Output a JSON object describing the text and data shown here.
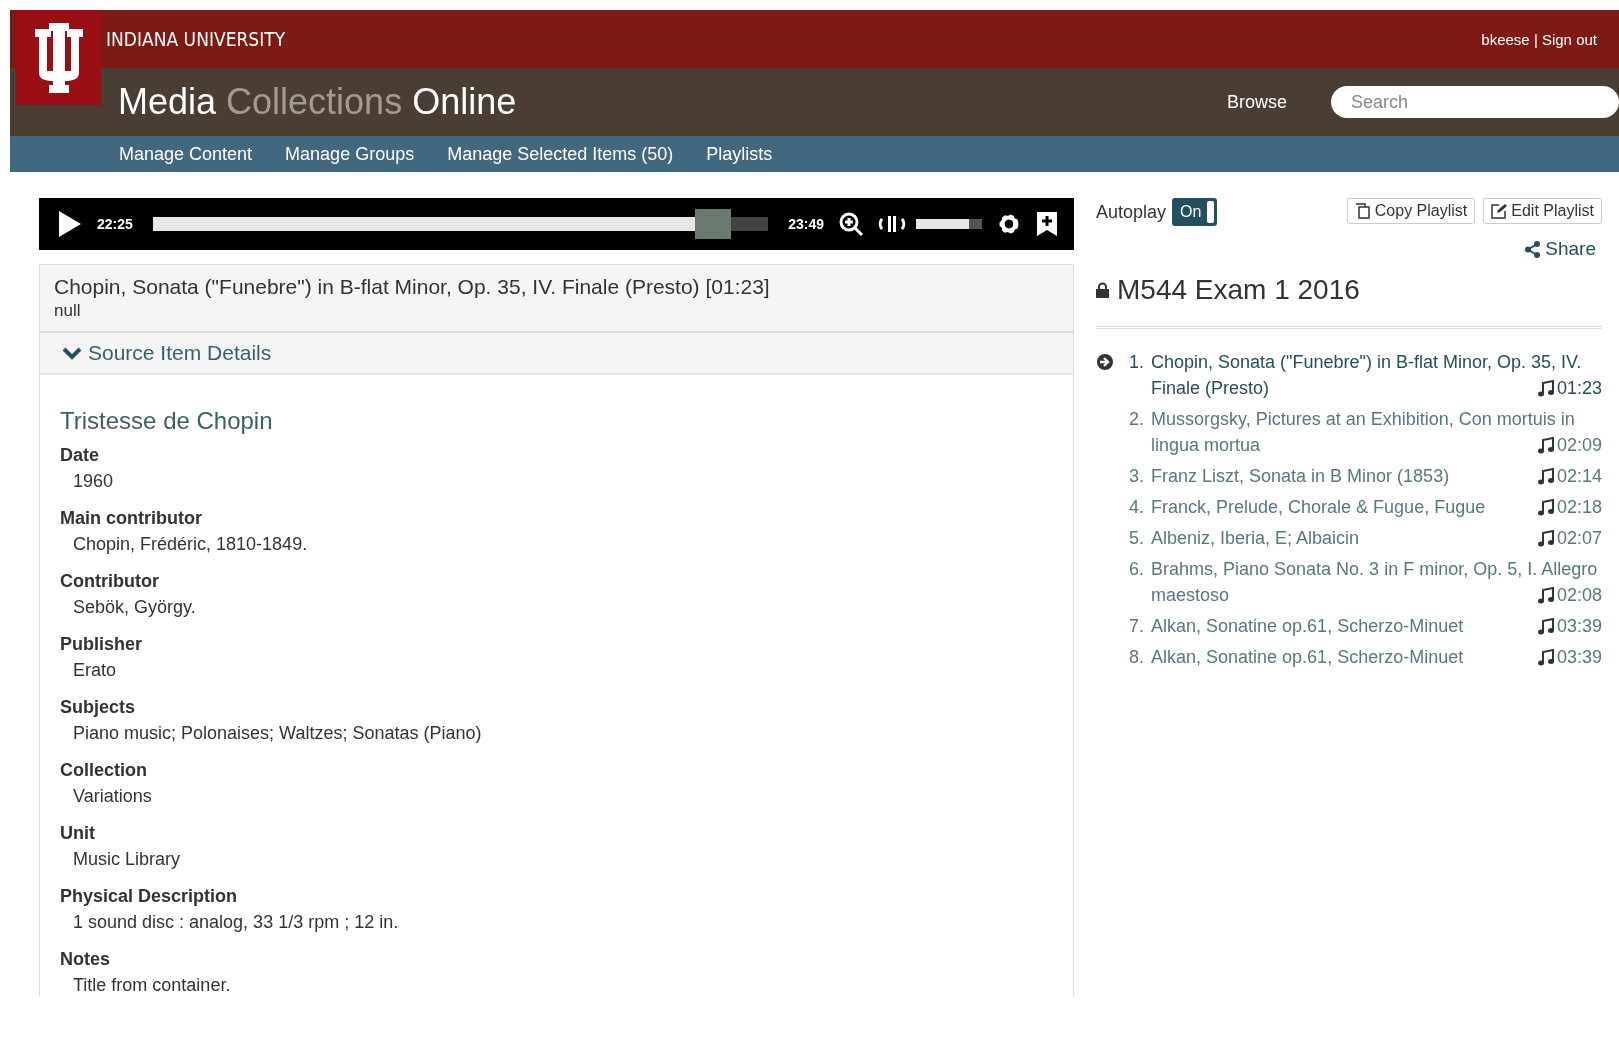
{
  "header": {
    "brand": "INDIANA UNIVERSITY",
    "user": "bkeese | Sign out",
    "title_parts": [
      {
        "text": "Media ",
        "muted": false
      },
      {
        "text": "Collections ",
        "muted": true
      },
      {
        "text": "Online",
        "muted": false
      }
    ],
    "browse": "Browse",
    "search": {
      "placeholder": "Search"
    }
  },
  "nav": [
    "Manage Content",
    "Manage Groups",
    "Manage Selected Items (50)",
    "Playlists"
  ],
  "player": {
    "current_time": "22:25",
    "duration": "23:49",
    "progress": {
      "level": 0.94
    },
    "volume": {
      "level": 0.8
    }
  },
  "item": {
    "title": "Chopin, Sonata (\"Funebre\") in B-flat Minor, Op. 35, IV. Finale (Presto) [01:23]",
    "subtitle": "null",
    "section": {
      "label": "Source Item Details",
      "expanded": true
    },
    "source_title": "Tristesse de Chopin",
    "fields": [
      {
        "label": "Date",
        "value": "1960"
      },
      {
        "label": "Main contributor",
        "value": "Chopin, Frédéric, 1810-1849."
      },
      {
        "label": "Contributor",
        "value": "Sebök, György."
      },
      {
        "label": "Publisher",
        "value": "Erato"
      },
      {
        "label": "Subjects",
        "value": "Piano music; Polonaises; Waltzes; Sonatas (Piano)"
      },
      {
        "label": "Collection",
        "value": "Variations"
      },
      {
        "label": "Unit",
        "value": "Music Library"
      },
      {
        "label": "Physical Description",
        "value": "1 sound disc : analog, 33 1/3 rpm ; 12 in."
      },
      {
        "label": "Notes",
        "value": "Title from container."
      }
    ]
  },
  "playlist": {
    "autoplay": {
      "label": "Autoplay",
      "state": "On",
      "on": true
    },
    "buttons": [
      "Copy Playlist",
      "Edit Playlist"
    ],
    "share": "Share",
    "title": "M544 Exam 1 2016",
    "items": [
      {
        "number": "1.",
        "title": "Chopin, Sonata (\"Funebre\") in B-flat Minor, Op. 35, IV. Finale (Presto)",
        "duration": "01:23",
        "selected": true
      },
      {
        "number": "2.",
        "title": "Mussorgsky, Pictures at an Exhibition, Con mortuis in lingua mortua",
        "duration": "02:09",
        "selected": false
      },
      {
        "number": "3.",
        "title": "Franz Liszt, Sonata in B Minor (1853)",
        "duration": "02:14",
        "selected": false
      },
      {
        "number": "4.",
        "title": "Franck, Prelude, Chorale & Fugue, Fugue",
        "duration": "02:18",
        "selected": false
      },
      {
        "number": "5.",
        "title": "Albeniz, Iberia, E; Albaicin",
        "duration": "02:07",
        "selected": false
      },
      {
        "number": "6.",
        "title": "Brahms, Piano Sonata No. 3 in F minor, Op. 5, I. Allegro maestoso",
        "duration": "02:08",
        "selected": false
      },
      {
        "number": "7.",
        "title": "Alkan, Sonatine op.61, Scherzo-Minuet",
        "duration": "03:39",
        "selected": false
      },
      {
        "number": "8.",
        "title": "Alkan, Sonatine op.61, Scherzo-Minuet",
        "duration": "03:39",
        "selected": false
      }
    ]
  }
}
